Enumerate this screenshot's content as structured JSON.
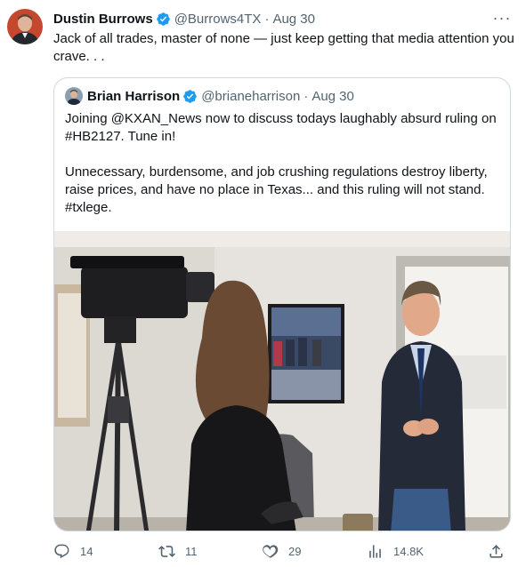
{
  "tweet": {
    "display_name": "Dustin Burrows",
    "handle": "@Burrows4TX",
    "separator": "·",
    "date": "Aug 30",
    "more_label": "···",
    "text": "Jack of all trades, master of none — just keep getting that media attention you crave. . ."
  },
  "quote": {
    "display_name": "Brian Harrison",
    "handle": "@brianeharrison",
    "separator": "·",
    "date": "Aug 30",
    "paragraph1": "Joining @KXAN_News now to discuss todays laughably absurd ruling on #HB2127.  Tune in!",
    "paragraph2": "Unnecessary, burdensome, and job crushing regulations destroy liberty, raise prices, and have no place in Texas... and this ruling will not stand.  #txlege."
  },
  "actions": {
    "replies": "14",
    "retweets": "11",
    "likes": "29",
    "views": "14.8K"
  },
  "colors": {
    "verified": "#1d9bf0",
    "secondary_text": "#536471",
    "border": "#cfd9de"
  },
  "icons": [
    "verified-badge-icon",
    "more-icon",
    "reply-icon",
    "retweet-icon",
    "like-icon",
    "views-icon",
    "share-icon"
  ]
}
